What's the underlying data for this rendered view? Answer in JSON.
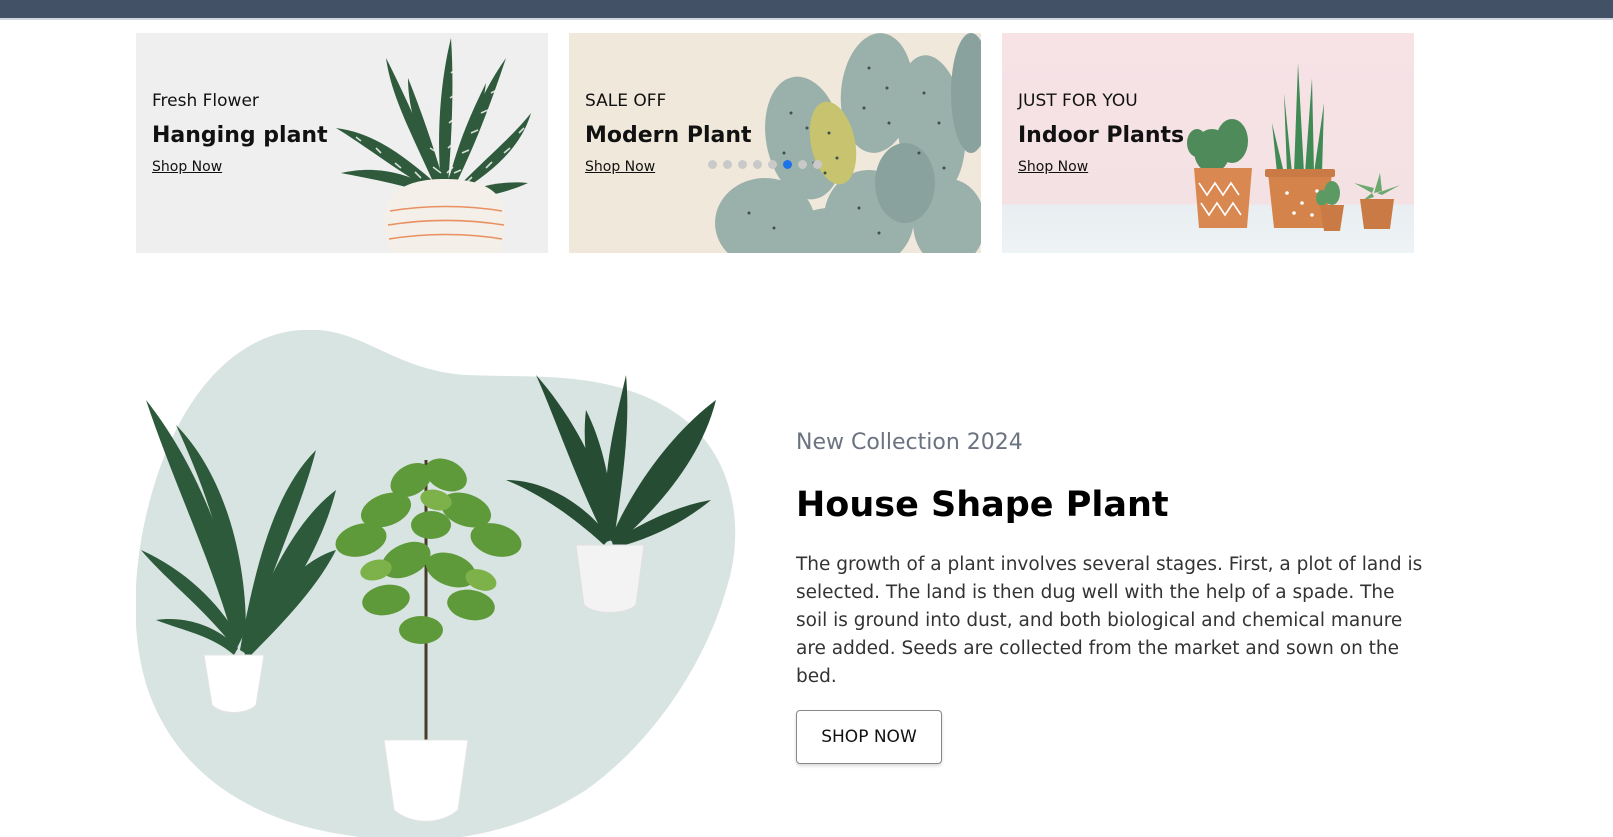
{
  "banners": [
    {
      "kicker": "Fresh Flower",
      "title": "Hanging plant",
      "link": "Shop Now"
    },
    {
      "kicker": "SALE OFF",
      "title": "Modern Plant",
      "link": "Shop Now"
    },
    {
      "kicker": "JUST FOR YOU",
      "title": "Indoor Plants",
      "link": "Shop Now"
    }
  ],
  "carousel": {
    "slide_count": 8,
    "active_slide": 6
  },
  "hero": {
    "kicker": "New Collection 2024",
    "title": "House Shape Plant",
    "description": "The growth of a plant involves several stages. First, a plot of land is selected. The land is then dug well with the help of a spade. The soil is ground into dust, and both biological and chemical manure are added. Seeds are collected from the market and sown on the bed.",
    "button_label": "SHOP NOW"
  },
  "colors": {
    "topbar": "#435166",
    "carousel_active": "#1e73e8",
    "hero_blob": "#d8e4e1"
  },
  "icons": [
    "zebra-plant-image",
    "cactus-image",
    "potted-cacti-image",
    "house-plants-image"
  ]
}
